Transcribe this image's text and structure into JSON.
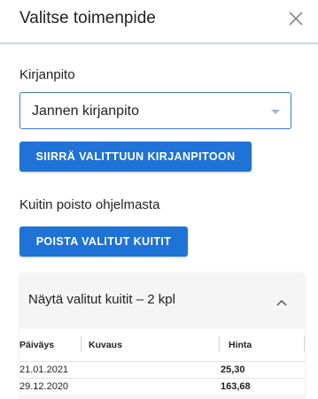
{
  "dialog": {
    "title": "Valitse toimenpide"
  },
  "ledger": {
    "label": "Kirjanpito",
    "selected_value": "Jannen kirjanpito",
    "move_button_label": "SIIRRÄ VALITTUUN KIRJANPITOON"
  },
  "delete": {
    "label": "Kuitin poisto ohjelmasta",
    "delete_button_label": "POISTA VALITUT KUITIT"
  },
  "selected_receipts": {
    "toggle_label": "Näytä valitut kuitit – 2 kpl",
    "columns": {
      "date": "Päiväys",
      "description": "Kuvaus",
      "price": "Hinta"
    },
    "rows": [
      {
        "date": "21.01.2021",
        "description": "",
        "price": "25,30"
      },
      {
        "date": "29.12.2020",
        "description": "",
        "price": "163,68"
      }
    ]
  },
  "colors": {
    "primary": "#1f72d6",
    "header_divider": "#c9d9ee",
    "panel_background": "#f5f5f5"
  }
}
